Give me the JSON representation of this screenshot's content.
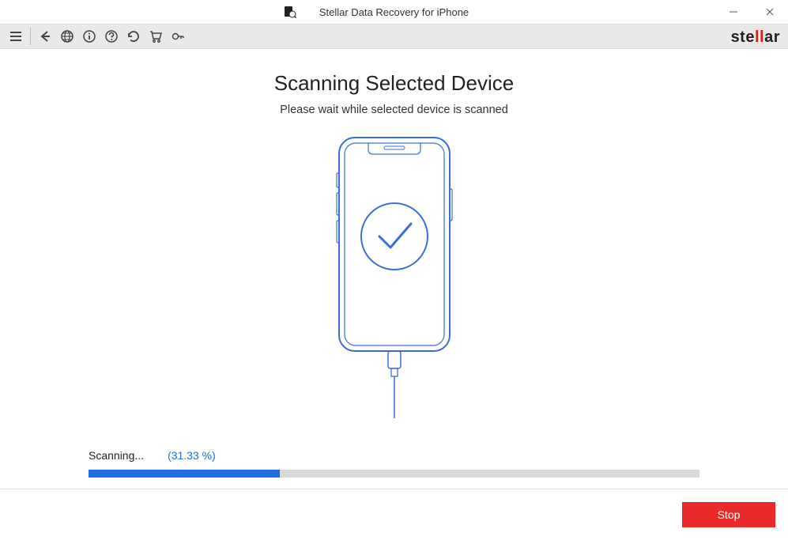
{
  "window": {
    "title": "Stellar Data Recovery for iPhone"
  },
  "brand": {
    "pre": "ste",
    "accent": "ll",
    "post": "ar"
  },
  "main": {
    "heading": "Scanning Selected Device",
    "subheading": "Please wait while selected device is scanned"
  },
  "progress": {
    "label": "Scanning...",
    "percent_text": "(31.33 %)",
    "percent_value": 31.33
  },
  "footer": {
    "stop_label": "Stop"
  }
}
